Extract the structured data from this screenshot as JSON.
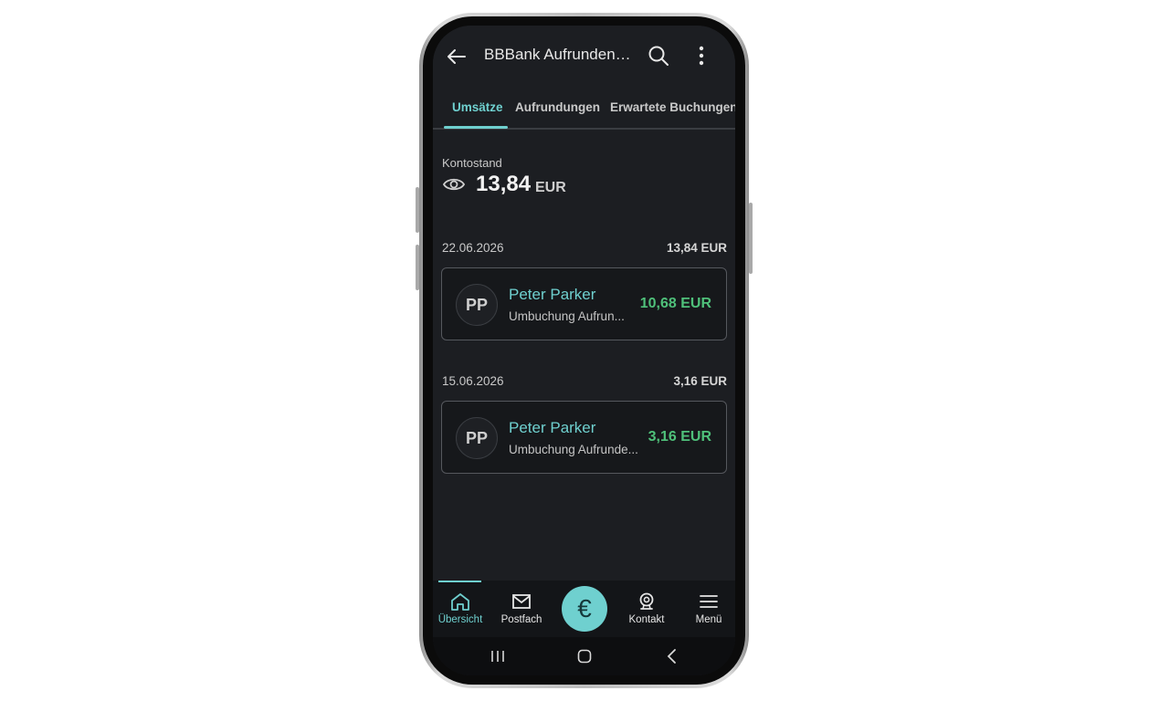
{
  "header": {
    "title": "BBBank AufrundenPl..."
  },
  "tabs": [
    {
      "label": "Umsätze",
      "active": true
    },
    {
      "label": "Aufrundungen",
      "active": false
    },
    {
      "label": "Erwartete Buchungen",
      "active": false
    }
  ],
  "balance": {
    "label": "Kontostand",
    "value": "13,84",
    "currency": "EUR"
  },
  "transaction_groups": [
    {
      "date": "22.06.2026",
      "total": "13,84 EUR",
      "transaction": {
        "initials": "PP",
        "name": "Peter Parker",
        "description": "Umbuchung Aufrun...",
        "amount": "10,68 EUR"
      }
    },
    {
      "date": "15.06.2026",
      "total": "3,16 EUR",
      "transaction": {
        "initials": "PP",
        "name": "Peter Parker",
        "description": "Umbuchung Aufrunde...",
        "amount": "3,16 EUR"
      }
    }
  ],
  "bottom_nav": {
    "items": [
      {
        "label": "Übersicht",
        "icon": "home-icon",
        "active": true
      },
      {
        "label": "Postfach",
        "icon": "mail-icon",
        "active": false
      },
      {
        "label": "€",
        "icon": "euro-icon",
        "active": false
      },
      {
        "label": "Kontakt",
        "icon": "contact-icon",
        "active": false
      },
      {
        "label": "Menü",
        "icon": "menu-icon",
        "active": false
      }
    ]
  },
  "colors": {
    "accent": "#6fd0cf",
    "positive": "#4fc07a",
    "background": "#1c1e22"
  }
}
